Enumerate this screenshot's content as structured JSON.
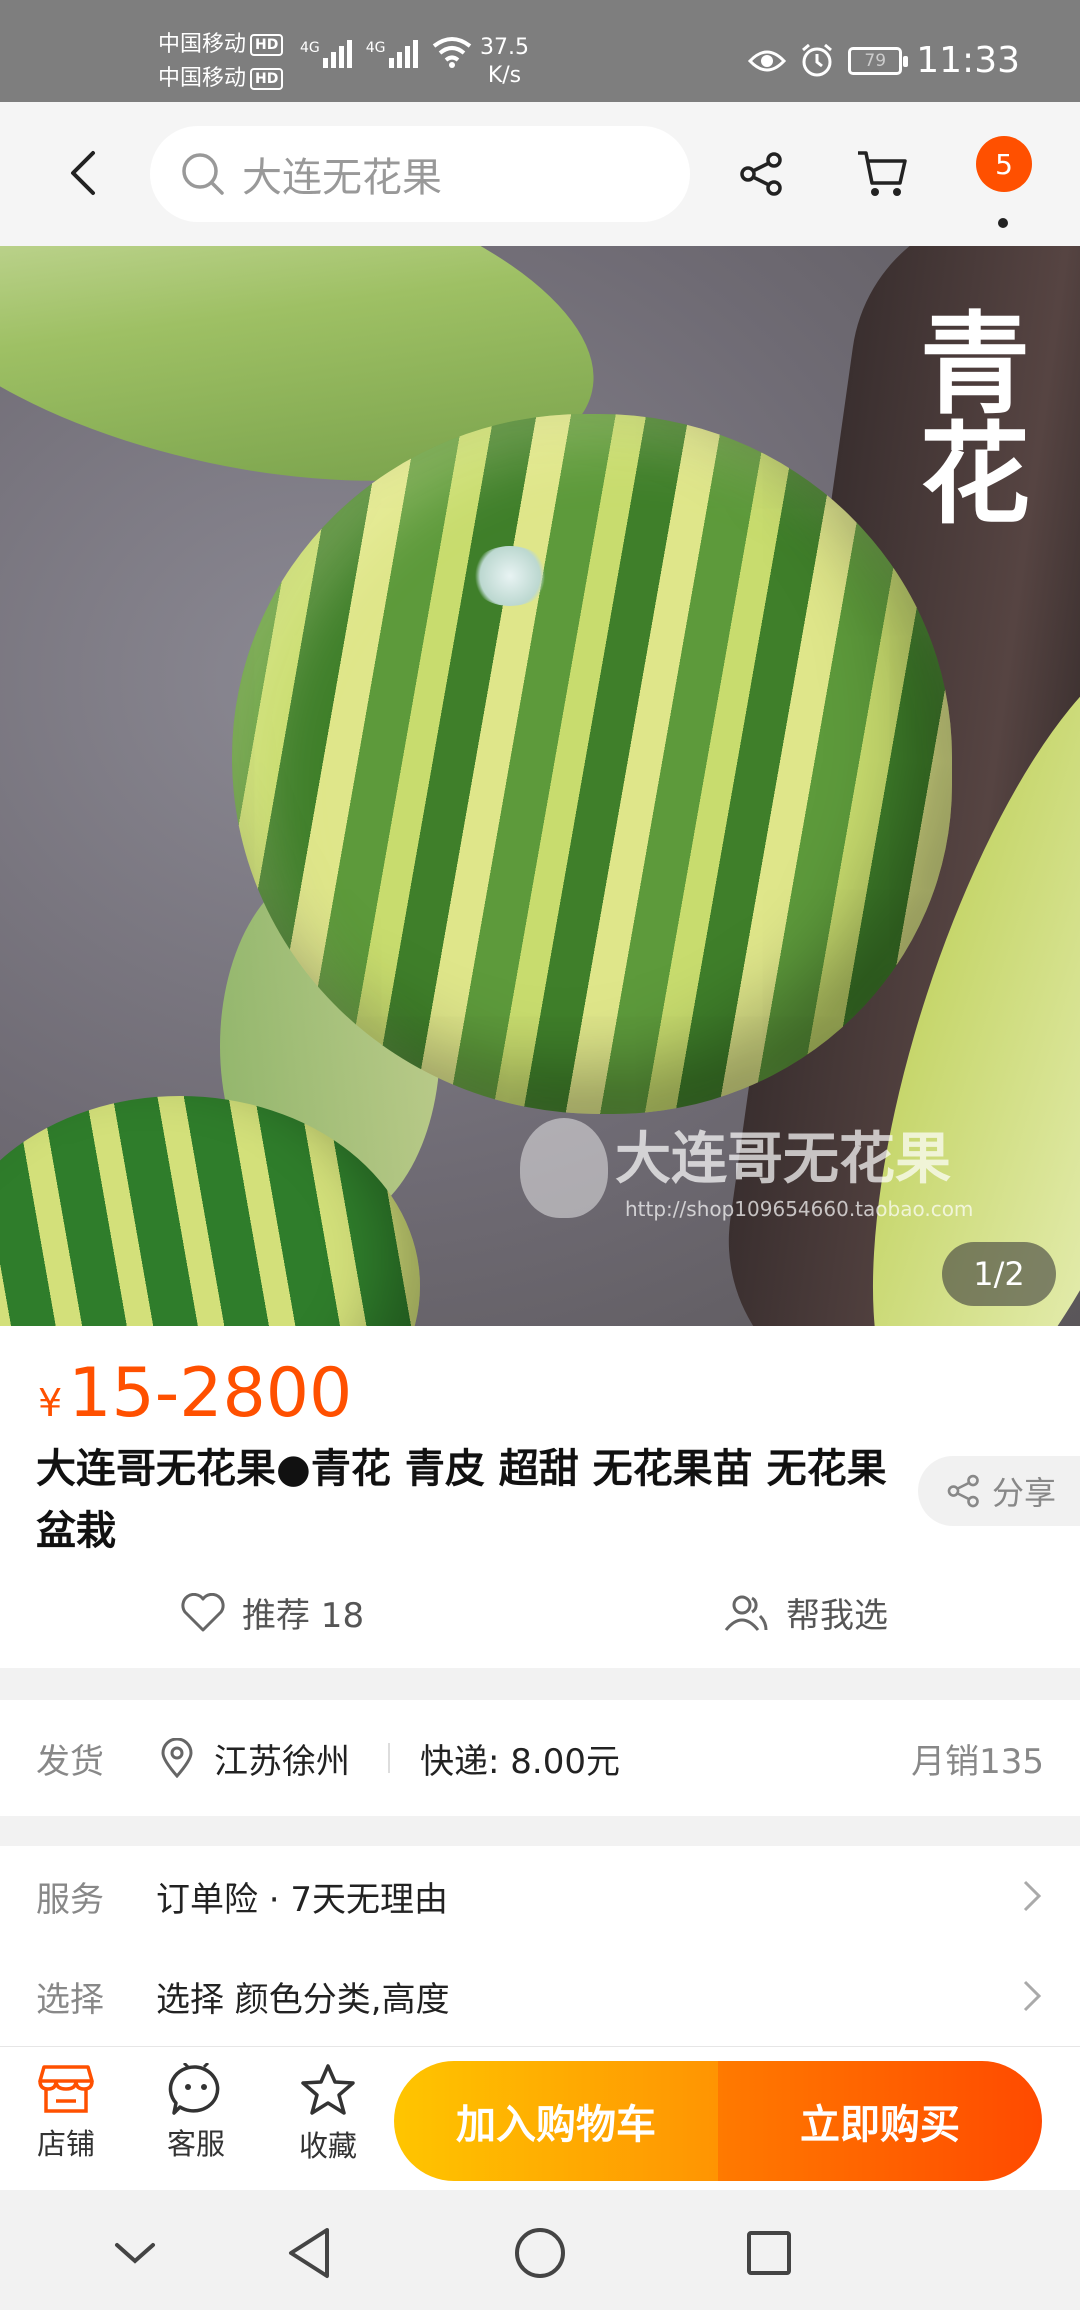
{
  "status_bar": {
    "carrier_1": "中国移动",
    "carrier_2": "中国移动",
    "hd_label": "HD",
    "network_1": "4G",
    "network_2": "4G",
    "speed_value": "37.5",
    "speed_unit": "K/s",
    "battery": "79",
    "time": "11:33"
  },
  "header": {
    "search_text": "大连无花果",
    "badge_count": "5"
  },
  "hero": {
    "title_overlay": "青花",
    "watermark_text": "大连哥无花果",
    "watermark_url": "http://shop109654660.taobao.com",
    "counter": "1/2"
  },
  "product": {
    "price_symbol": "¥",
    "price_range": "15-2800",
    "title": "大连哥无花果●青花 青皮 超甜 无花果苗 无花果盆栽",
    "share_label": "分享",
    "recommend_label": "推荐 18",
    "help_choose_label": "帮我选"
  },
  "shipping": {
    "label": "发货",
    "location": "江苏徐州",
    "express": "快递: 8.00元",
    "monthly_sales": "月销135"
  },
  "service": {
    "label": "服务",
    "value": "订单险 · 7天无理由"
  },
  "select": {
    "label": "选择",
    "value": "选择 颜色分类,高度"
  },
  "bottom_bar": {
    "store_label": "店铺",
    "service_label": "客服",
    "favorite_label": "收藏",
    "add_to_cart": "加入购物车",
    "buy_now": "立即购买"
  },
  "colors": {
    "accent": "#ff5000",
    "cart_start": "#ffc500",
    "buy_end": "#ff4a00"
  }
}
